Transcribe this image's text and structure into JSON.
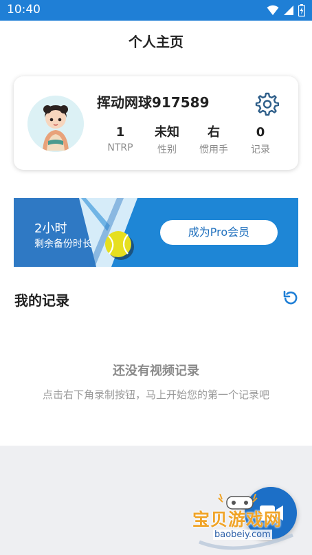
{
  "status_bar": {
    "time": "10:40"
  },
  "header": {
    "title": "个人主页"
  },
  "profile": {
    "username": "挥动网球917589",
    "stats": [
      {
        "value": "1",
        "label": "NTRP"
      },
      {
        "value": "未知",
        "label": "性别"
      },
      {
        "value": "右",
        "label": "惯用手"
      },
      {
        "value": "0",
        "label": "记录"
      }
    ]
  },
  "banner": {
    "hours": "2小时",
    "subtitle": "剩余备份时长",
    "button_label": "成为Pro会员"
  },
  "records": {
    "title": "我的记录",
    "empty_title": "还没有视频记录",
    "empty_subtitle": "点击右下角录制按钮，马上开始您的第一个记录吧"
  },
  "watermark": {
    "text": "宝贝游戏网",
    "url": "baobeiy.com"
  },
  "colors": {
    "brand_blue": "#1e86d6",
    "status_bar": "#1f7fd6",
    "ball_yellow": "#e6df1f"
  },
  "icons": [
    "wifi-icon",
    "signal-icon",
    "battery-icon",
    "gear-icon",
    "refresh-icon",
    "tennis-ball-icon",
    "record-icon"
  ]
}
